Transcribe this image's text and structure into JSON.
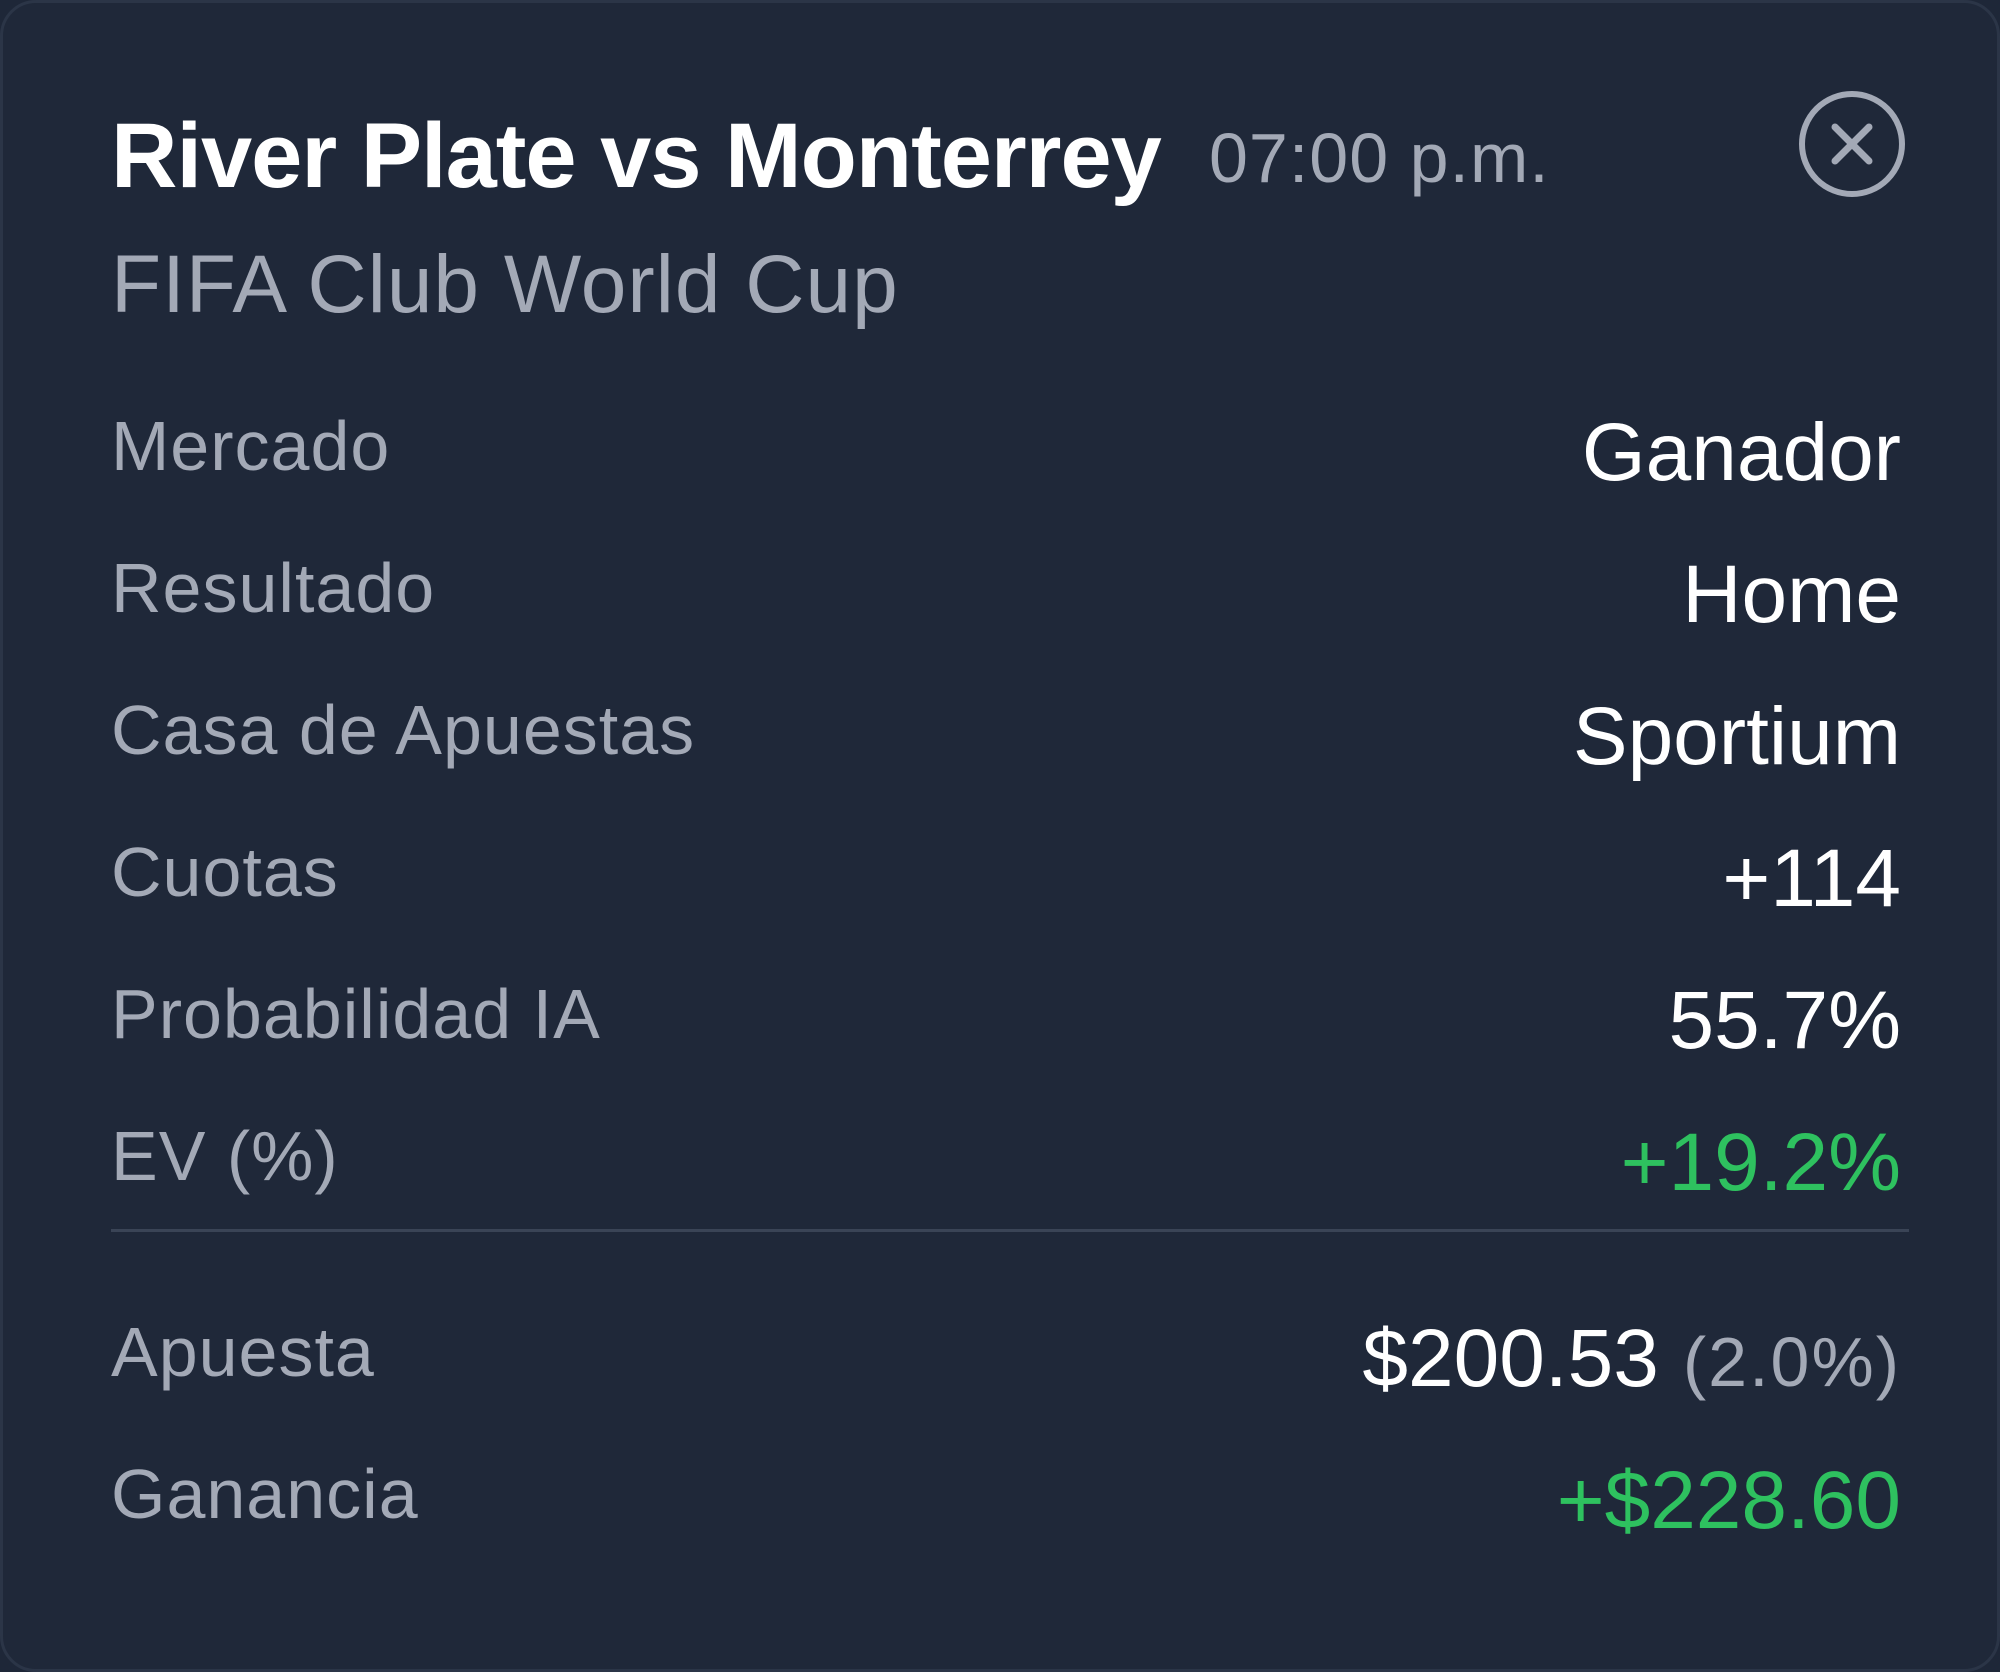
{
  "header": {
    "title": "River Plate vs Monterrey",
    "time": "07:00 p.m.",
    "close_icon": "close-icon"
  },
  "league": "FIFA Club World Cup",
  "details": {
    "market_label": "Mercado",
    "market_value": "Ganador",
    "result_label": "Resultado",
    "result_value": "Home",
    "bookmaker_label": "Casa de Apuestas",
    "bookmaker_value": "Sportium",
    "odds_label": "Cuotas",
    "odds_value": "+114",
    "probability_label": "Probabilidad IA",
    "probability_value": "55.7%",
    "ev_label": "EV (%)",
    "ev_value": "+19.2%"
  },
  "summary": {
    "stake_label": "Apuesta",
    "stake_amount": "$200.53",
    "stake_percent": "(2.0%)",
    "profit_label": "Ganancia",
    "profit_value": "+$228.60"
  },
  "colors": {
    "background": "#1f2839",
    "text_primary": "#ffffff",
    "text_secondary": "#a3a9b6",
    "positive": "#2ec15f",
    "divider": "#3a4456"
  }
}
